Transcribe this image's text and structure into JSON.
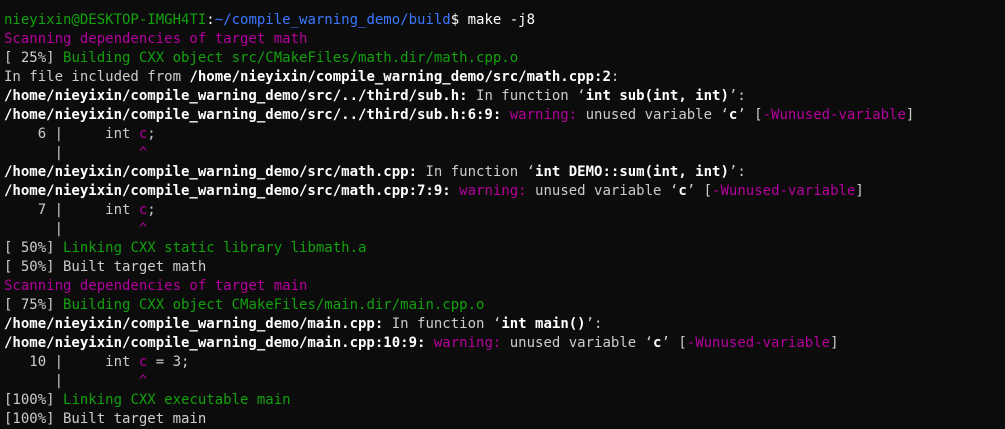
{
  "colors": {
    "background": "#0c0c0c",
    "foreground": "#cccccc",
    "green": "#13a10e",
    "blue": "#3b78ff",
    "magenta": "#b4009e",
    "white": "#ffffff"
  },
  "lines": [
    {
      "name": "prompt-line",
      "segments": [
        {
          "text": "nieyixin@DESKTOP-IMGH4TI",
          "color": "green"
        },
        {
          "text": ":",
          "color": "white"
        },
        {
          "text": "~/compile_warning_demo/build",
          "color": "blue"
        },
        {
          "text": "$ make -j8",
          "color": "white"
        }
      ]
    },
    {
      "name": "scan-deps-math",
      "segments": [
        {
          "text": "Scanning dependencies of target math",
          "color": "magenta"
        }
      ]
    },
    {
      "name": "build-progress-math-obj",
      "segments": [
        {
          "text": "[ 25%] ",
          "color": "default"
        },
        {
          "text": "Building CXX object src/CMakeFiles/math.dir/math.cpp.o",
          "color": "green"
        }
      ]
    },
    {
      "name": "include-note",
      "segments": [
        {
          "text": "In file included from ",
          "color": "default"
        },
        {
          "text": "/home/nieyixin/compile_warning_demo/src/math.cpp:2",
          "color": "white",
          "bold": true
        },
        {
          "text": ":",
          "color": "default"
        }
      ]
    },
    {
      "name": "function-context-sub",
      "segments": [
        {
          "text": "/home/nieyixin/compile_warning_demo/src/../third/sub.h:",
          "color": "white",
          "bold": true
        },
        {
          "text": " In function ‘",
          "color": "default"
        },
        {
          "text": "int sub(int, int)",
          "color": "white",
          "bold": true
        },
        {
          "text": "’:",
          "color": "default"
        }
      ]
    },
    {
      "name": "warning-line-sub",
      "segments": [
        {
          "text": "/home/nieyixin/compile_warning_demo/src/../third/sub.h:6:9:",
          "color": "white",
          "bold": true
        },
        {
          "text": " ",
          "color": "default"
        },
        {
          "text": "warning:",
          "color": "magenta"
        },
        {
          "text": " unused variable ‘",
          "color": "default"
        },
        {
          "text": "c",
          "color": "white",
          "bold": true
        },
        {
          "text": "’ [",
          "color": "default"
        },
        {
          "text": "-Wunused-variable",
          "color": "magenta"
        },
        {
          "text": "]",
          "color": "default"
        }
      ]
    },
    {
      "name": "source-line-sub",
      "segments": [
        {
          "text": "    6 |     int ",
          "color": "default"
        },
        {
          "text": "c",
          "color": "magenta"
        },
        {
          "text": ";",
          "color": "default"
        }
      ]
    },
    {
      "name": "caret-line-sub",
      "segments": [
        {
          "text": "      |         ",
          "color": "default"
        },
        {
          "text": "^",
          "color": "magenta"
        }
      ]
    },
    {
      "name": "function-context-math",
      "segments": [
        {
          "text": "/home/nieyixin/compile_warning_demo/src/math.cpp:",
          "color": "white",
          "bold": true
        },
        {
          "text": " In function ‘",
          "color": "default"
        },
        {
          "text": "int DEMO::sum(int, int)",
          "color": "white",
          "bold": true
        },
        {
          "text": "’:",
          "color": "default"
        }
      ]
    },
    {
      "name": "warning-line-math",
      "segments": [
        {
          "text": "/home/nieyixin/compile_warning_demo/src/math.cpp:7:9:",
          "color": "white",
          "bold": true
        },
        {
          "text": " ",
          "color": "default"
        },
        {
          "text": "warning:",
          "color": "magenta"
        },
        {
          "text": " unused variable ‘",
          "color": "default"
        },
        {
          "text": "c",
          "color": "white",
          "bold": true
        },
        {
          "text": "’ [",
          "color": "default"
        },
        {
          "text": "-Wunused-variable",
          "color": "magenta"
        },
        {
          "text": "]",
          "color": "default"
        }
      ]
    },
    {
      "name": "source-line-math",
      "segments": [
        {
          "text": "    7 |     int ",
          "color": "default"
        },
        {
          "text": "c",
          "color": "magenta"
        },
        {
          "text": ";",
          "color": "default"
        }
      ]
    },
    {
      "name": "caret-line-math",
      "segments": [
        {
          "text": "      |         ",
          "color": "default"
        },
        {
          "text": "^",
          "color": "magenta"
        }
      ]
    },
    {
      "name": "link-static-lib",
      "segments": [
        {
          "text": "[ 50%] ",
          "color": "default"
        },
        {
          "text": "Linking CXX static library libmath.a",
          "color": "green"
        }
      ]
    },
    {
      "name": "built-target-math",
      "segments": [
        {
          "text": "[ 50%] Built target math",
          "color": "default"
        }
      ]
    },
    {
      "name": "scan-deps-main",
      "segments": [
        {
          "text": "Scanning dependencies of target main",
          "color": "magenta"
        }
      ]
    },
    {
      "name": "build-progress-main-obj",
      "segments": [
        {
          "text": "[ 75%] ",
          "color": "default"
        },
        {
          "text": "Building CXX object CMakeFiles/main.dir/main.cpp.o",
          "color": "green"
        }
      ]
    },
    {
      "name": "function-context-main",
      "segments": [
        {
          "text": "/home/nieyixin/compile_warning_demo/main.cpp:",
          "color": "white",
          "bold": true
        },
        {
          "text": " In function ‘",
          "color": "default"
        },
        {
          "text": "int main()",
          "color": "white",
          "bold": true
        },
        {
          "text": "’:",
          "color": "default"
        }
      ]
    },
    {
      "name": "warning-line-main",
      "segments": [
        {
          "text": "/home/nieyixin/compile_warning_demo/main.cpp:10:9:",
          "color": "white",
          "bold": true
        },
        {
          "text": " ",
          "color": "default"
        },
        {
          "text": "warning:",
          "color": "magenta"
        },
        {
          "text": " unused variable ‘",
          "color": "default"
        },
        {
          "text": "c",
          "color": "white",
          "bold": true
        },
        {
          "text": "’ [",
          "color": "default"
        },
        {
          "text": "-Wunused-variable",
          "color": "magenta"
        },
        {
          "text": "]",
          "color": "default"
        }
      ]
    },
    {
      "name": "source-line-main",
      "segments": [
        {
          "text": "   10 |     int ",
          "color": "default"
        },
        {
          "text": "c",
          "color": "magenta"
        },
        {
          "text": " = 3;",
          "color": "default"
        }
      ]
    },
    {
      "name": "caret-line-main",
      "segments": [
        {
          "text": "      |         ",
          "color": "default"
        },
        {
          "text": "^",
          "color": "magenta"
        }
      ]
    },
    {
      "name": "link-executable",
      "segments": [
        {
          "text": "[100%] ",
          "color": "default"
        },
        {
          "text": "Linking CXX executable main",
          "color": "green"
        }
      ]
    },
    {
      "name": "built-target-main",
      "segments": [
        {
          "text": "[100%] Built target main",
          "color": "default"
        }
      ]
    }
  ]
}
